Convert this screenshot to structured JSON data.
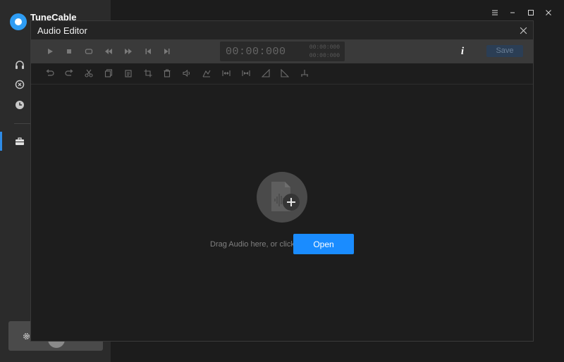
{
  "app": {
    "title": "TuneCable",
    "sidebar_icons": [
      "headphones-icon",
      "music-note-icon",
      "clock-icon",
      "toolbox-icon"
    ],
    "accent": "#2e8be6"
  },
  "window_controls": [
    "menu-icon",
    "minimize-icon",
    "maximize-icon",
    "close-icon"
  ],
  "dialog": {
    "title": "Audio Editor",
    "transport": {
      "buttons": [
        "play-icon",
        "stop-icon",
        "loop-icon",
        "rewind-icon",
        "fast-forward-icon",
        "skip-start-icon",
        "skip-end-icon"
      ],
      "time_main": "00:00:000",
      "time_small_1": "00:00:000",
      "time_small_2": "00:00:000",
      "info_label": "i",
      "save_label": "Save"
    },
    "edit_tools": [
      "undo-icon",
      "redo-icon",
      "cut-icon",
      "copy-icon",
      "paste-icon",
      "crop-icon",
      "delete-icon",
      "volume-icon",
      "amplify-icon",
      "expand-icon",
      "compress-icon",
      "fade-in-icon",
      "fade-out-icon",
      "split-icon"
    ],
    "drop_zone": {
      "hint": "Drag Audio here, or click",
      "open_label": "Open",
      "open_color": "#1a8cff"
    }
  }
}
